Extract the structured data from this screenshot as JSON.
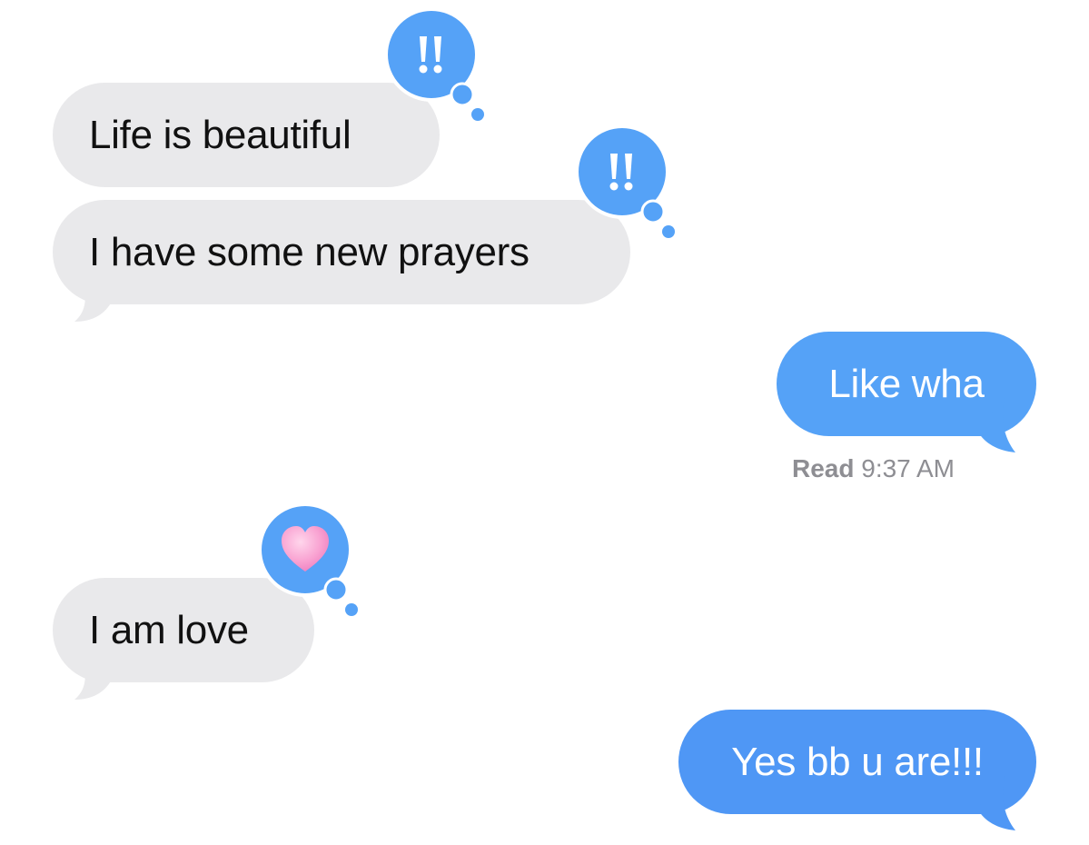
{
  "colors": {
    "incoming_bubble": "#e9e9eb",
    "outgoing_bubble": "#55a2f7",
    "tapback": "#55a2f7",
    "receipt_text": "#8e8e93"
  },
  "messages": [
    {
      "direction": "incoming",
      "text": "Life is beautiful",
      "tapback_icon": "exclamation-icon"
    },
    {
      "direction": "incoming",
      "text": "I have some new prayers",
      "tapback_icon": "exclamation-icon"
    },
    {
      "direction": "outgoing",
      "text": "Like wha"
    },
    {
      "direction": "incoming",
      "text": "I am love",
      "tapback_icon": "heart-icon"
    },
    {
      "direction": "outgoing",
      "text": "Yes bb u are!!!"
    }
  ],
  "receipt": {
    "label": "Read",
    "time": "9:37 AM"
  }
}
